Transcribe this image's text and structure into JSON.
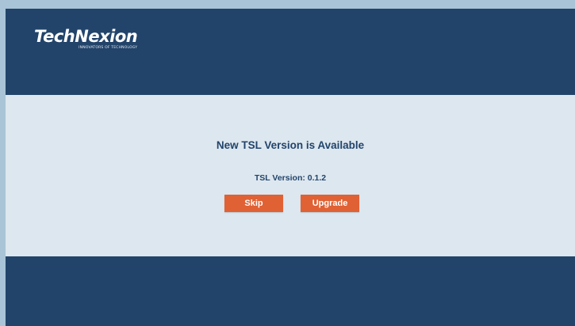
{
  "brand": {
    "name": "TechNexion",
    "tagline": "INNOVATORS OF TECHNOLOGY"
  },
  "dialog": {
    "title": "New TSL Version is Available",
    "version_text": "TSL Version: 0.1.2",
    "skip_label": "Skip",
    "upgrade_label": "Upgrade"
  },
  "colors": {
    "header_bg": "#22446b",
    "content_bg": "#dde7ef",
    "button_bg": "#e06133",
    "outer_bg": "#a9c4d6"
  }
}
